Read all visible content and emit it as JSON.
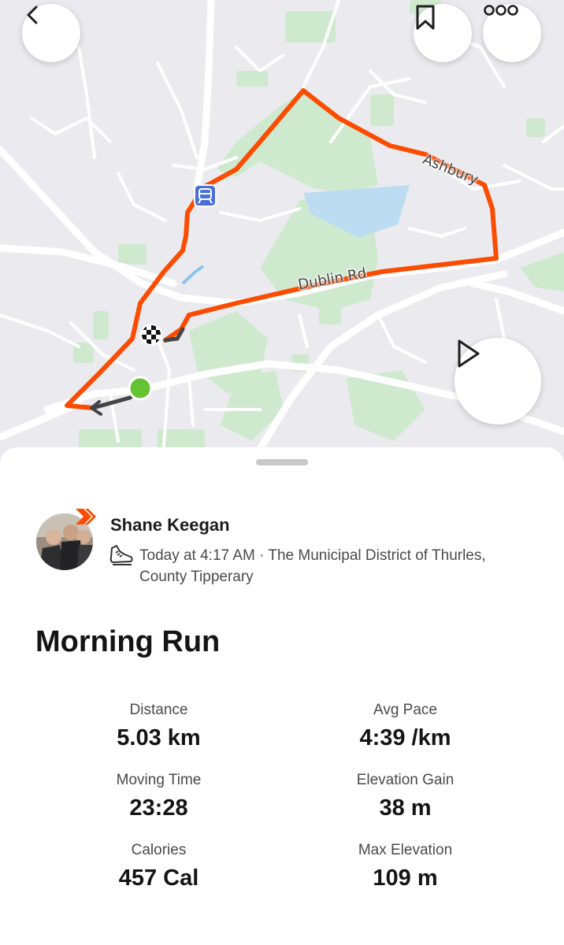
{
  "map": {
    "labels": {
      "road_1": "Ashbury",
      "road_2": "Dublin Rd"
    },
    "colors": {
      "route": "#fc4c02",
      "start": "#64c332",
      "land": "#ebebef",
      "park": "#cfe9cf",
      "water": "#bcdcf2",
      "road": "#ffffff"
    },
    "icons": [
      "back-chevron-icon",
      "bookmark-icon",
      "more-options-icon",
      "play-icon",
      "train-station-icon",
      "finish-flag-icon"
    ]
  },
  "activity": {
    "athlete_name": "Shane Keegan",
    "meta_text": "Today at 4:17 AM · The Municipal District of Thurles, County Tipperary",
    "title": "Morning Run",
    "sport_icon": "running-shoe-icon"
  },
  "stats": [
    {
      "label": "Distance",
      "value": "5.03 km"
    },
    {
      "label": "Avg Pace",
      "value": "4:39 /km"
    },
    {
      "label": "Moving Time",
      "value": "23:28"
    },
    {
      "label": "Elevation Gain",
      "value": "38 m"
    },
    {
      "label": "Calories",
      "value": "457 Cal"
    },
    {
      "label": "Max Elevation",
      "value": "109 m"
    }
  ]
}
